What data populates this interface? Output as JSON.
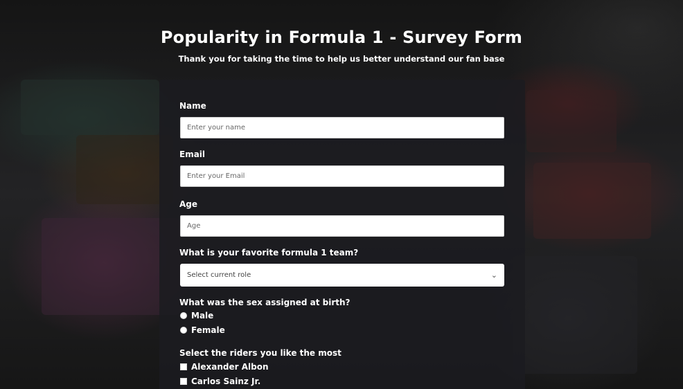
{
  "page": {
    "title": "Popularity in Formula 1 - Survey Form",
    "subtitle": "Thank you for taking the time to help us better understand our fan base"
  },
  "form": {
    "name": {
      "label": "Name",
      "placeholder": "Enter your name",
      "value": ""
    },
    "email": {
      "label": "Email",
      "placeholder": "Enter your Email",
      "value": ""
    },
    "age": {
      "label": "Age",
      "placeholder": "Age",
      "value": ""
    },
    "team": {
      "label": "What is your favorite formula 1 team?",
      "selected": "Select current role"
    },
    "sex": {
      "label": "What was the sex assigned at birth?",
      "options": [
        "Male",
        "Female"
      ]
    },
    "riders": {
      "label": "Select the riders you like the most",
      "options": [
        "Alexander Albon",
        "Carlos Sainz Jr."
      ]
    }
  },
  "icons": {
    "select_arrow": "chevron-down-icon"
  },
  "colors": {
    "background": "#1c1c1e",
    "card": "#1b1b20",
    "text": "#ffffff"
  }
}
